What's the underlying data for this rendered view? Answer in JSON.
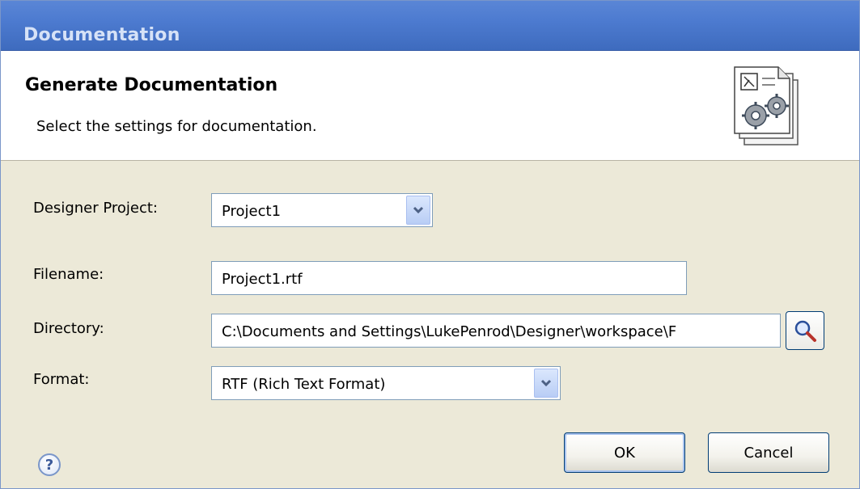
{
  "window": {
    "title": "Documentation"
  },
  "banner": {
    "heading": "Generate Documentation",
    "subtitle": "Select the settings for documentation.",
    "icon": "document-gears-icon"
  },
  "form": {
    "designer_project": {
      "label": "Designer Project:",
      "value": "Project1"
    },
    "filename": {
      "label": "Filename:",
      "value": "Project1.rtf"
    },
    "directory": {
      "label": "Directory:",
      "value": "C:\\Documents and Settings\\LukePenrod\\Designer\\workspace\\F"
    },
    "format": {
      "label": "Format:",
      "value": "RTF (Rich Text Format)"
    }
  },
  "icons": {
    "browse": "magnifier-icon",
    "help": "help-icon",
    "dropdown": "chevron-down-icon"
  },
  "footer": {
    "help_glyph": "?",
    "ok_label": "OK",
    "cancel_label": "Cancel"
  },
  "colors": {
    "titlebar": "#4d7bd0",
    "dialog_bg": "#ece9d8",
    "field_border": "#7f9db9"
  }
}
